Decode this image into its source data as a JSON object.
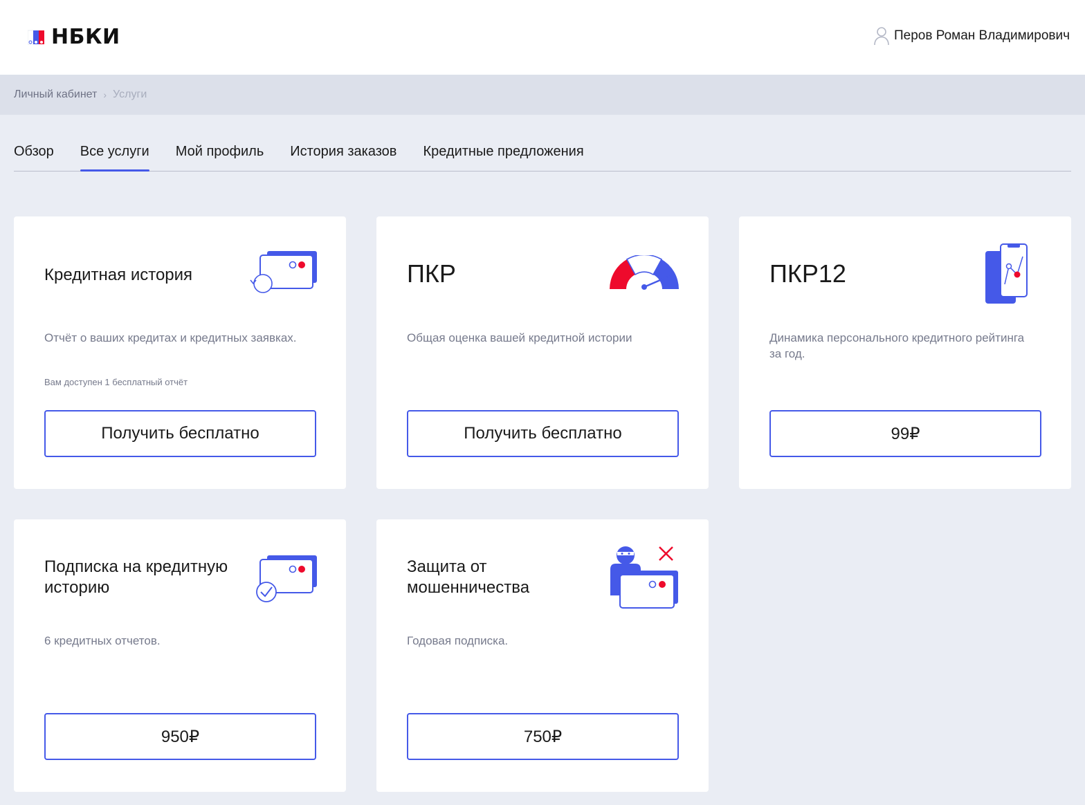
{
  "header": {
    "logo_text": "НБКИ",
    "user_name": "Перов Роман Владимирович"
  },
  "breadcrumb": {
    "items": [
      "Личный кабинет",
      "Услуги"
    ],
    "separator": "›"
  },
  "tabs": [
    {
      "label": "Обзор",
      "active": false
    },
    {
      "label": "Все услуги",
      "active": true
    },
    {
      "label": "Мой профиль",
      "active": false
    },
    {
      "label": "История заказов",
      "active": false
    },
    {
      "label": "Кредитные предложения",
      "active": false
    }
  ],
  "cards": [
    {
      "title": "Кредитная история",
      "description": "Отчёт о ваших кредитах и кредитных заявках.",
      "note": "Вам доступен 1 бесплатный отчёт",
      "button": "Получить бесплатно",
      "icon": "credit-card-refresh-icon"
    },
    {
      "title": "ПКР",
      "description": "Общая оценка вашей кредитной истории",
      "note": "",
      "button": "Получить бесплатно",
      "icon": "speedometer-icon"
    },
    {
      "title": "ПКР12",
      "description": "Динамика персонального кредитного рейтинга за год.",
      "note": "",
      "button": "99₽",
      "icon": "phone-chart-icon"
    },
    {
      "title": "Подписка на кредитную историю",
      "description": "6 кредитных отчетов.",
      "note": "",
      "button": "950₽",
      "icon": "credit-card-check-icon"
    },
    {
      "title": "Защита от мошенничества",
      "description": "Годовая подписка.",
      "note": "",
      "button": "750₽",
      "icon": "fraud-protection-icon"
    }
  ],
  "colors": {
    "accent": "#4559e8",
    "alert": "#ee0a2c",
    "background": "#eaedf4",
    "breadcrumb_bg": "#dce0ea",
    "muted_text": "#767a8c"
  }
}
